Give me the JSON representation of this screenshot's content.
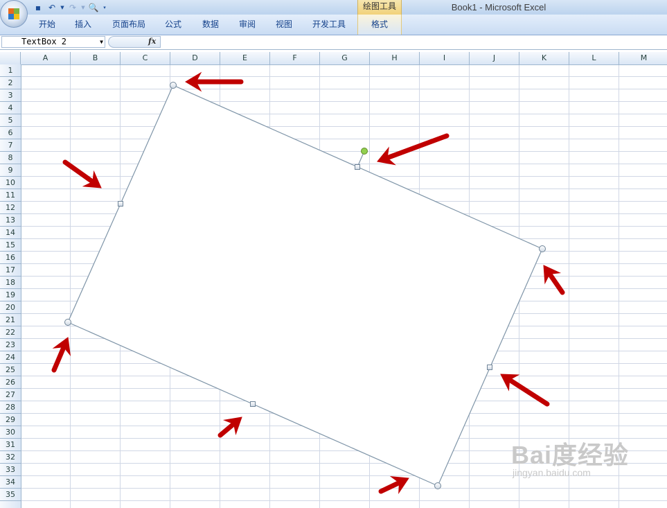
{
  "window": {
    "title": "Book1 - Microsoft Excel",
    "contextual_group": "绘图工具"
  },
  "ribbon": {
    "tabs": [
      {
        "label": "开始"
      },
      {
        "label": "插入"
      },
      {
        "label": "页面布局"
      },
      {
        "label": "公式"
      },
      {
        "label": "数据"
      },
      {
        "label": "审阅"
      },
      {
        "label": "视图"
      },
      {
        "label": "开发工具"
      },
      {
        "label": "格式"
      }
    ]
  },
  "formula_bar": {
    "name_box": "TextBox 2",
    "fx_label": "fx",
    "content": ""
  },
  "sheet": {
    "columns": [
      "A",
      "B",
      "C",
      "D",
      "E",
      "F",
      "G",
      "H",
      "I",
      "J",
      "K",
      "L",
      "M"
    ],
    "rows": [
      "1",
      "2",
      "3",
      "4",
      "5",
      "6",
      "7",
      "8",
      "9",
      "10",
      "11",
      "12",
      "13",
      "14",
      "15",
      "16",
      "17",
      "18",
      "19",
      "20",
      "21",
      "22",
      "23",
      "24",
      "25",
      "26",
      "27",
      "28",
      "29",
      "30",
      "31",
      "32",
      "33",
      "34",
      "35"
    ]
  },
  "shape": {
    "name": "TextBox 2",
    "rotation_handle_color": "#92d050",
    "outline_color": "#7f95a8"
  },
  "annotation_arrows": {
    "color": "#c00000",
    "count": 9
  },
  "watermark": {
    "brand": "Bai度经验",
    "url": "jingyan.baidu.com"
  }
}
